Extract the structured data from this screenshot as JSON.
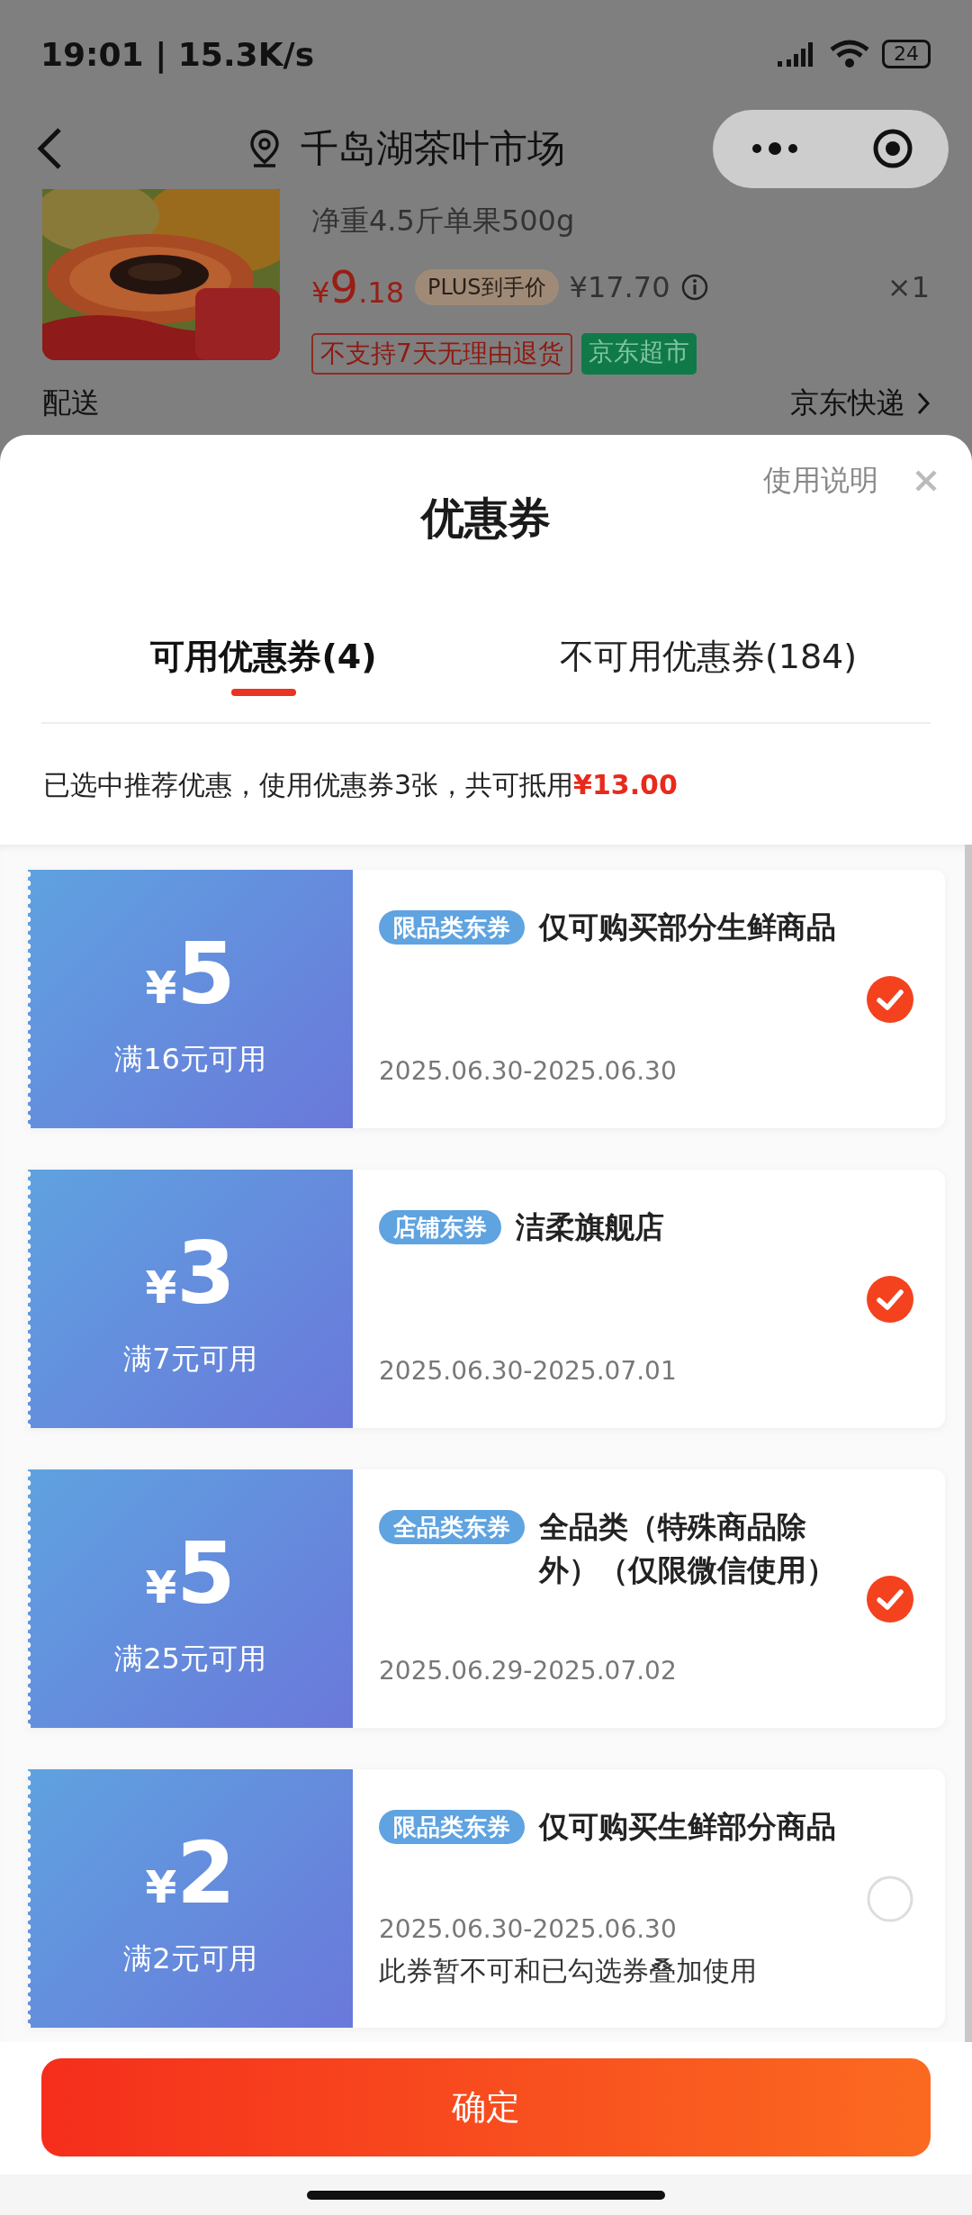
{
  "status_bar": {
    "time": "19:01 | 15.3K/s",
    "battery": "24"
  },
  "nav": {
    "title": "千岛湖茶叶市场"
  },
  "product": {
    "subtitle": "净重4.5斤单果500g",
    "currency": "¥",
    "price_int": "9",
    "price_dec": ".18",
    "price_tag": "PLUS到手价",
    "original_price": "¥17.70",
    "quantity": "×1",
    "tags": [
      {
        "text": "不支持7天无理由退货",
        "kind": "outline"
      },
      {
        "text": "京东超市",
        "kind": "filled"
      }
    ]
  },
  "delivery": {
    "label": "配送",
    "value": "京东快递"
  },
  "sheet": {
    "help": "使用说明",
    "title": "优惠券",
    "tabs": [
      {
        "label": "可用优惠券(4)",
        "selected": true
      },
      {
        "label": "不可用优惠券(184)",
        "selected": false
      }
    ],
    "summary": "已选中推荐优惠，使用优惠券3张，共可抵用",
    "summary_amount": "¥13.00"
  },
  "coupons": [
    {
      "currency": "¥",
      "amount": "5",
      "condition": "满16元可用",
      "badge": "限品类东券",
      "title": "仅可购买部分生鲜商品",
      "validity": "2025.06.30-2025.06.30",
      "selected": true
    },
    {
      "currency": "¥",
      "amount": "3",
      "condition": "满7元可用",
      "badge": "店铺东券",
      "title": "洁柔旗舰店",
      "validity": "2025.06.30-2025.07.01",
      "selected": true
    },
    {
      "currency": "¥",
      "amount": "5",
      "condition": "满25元可用",
      "badge": "全品类东券",
      "title": "全品类（特殊商品除外）（仅限微信使用）",
      "validity": "2025.06.29-2025.07.02",
      "selected": true
    },
    {
      "currency": "¥",
      "amount": "2",
      "condition": "满2元可用",
      "badge": "限品类东券",
      "title": "仅可购买生鲜部分商品",
      "validity": "2025.06.30-2025.06.30",
      "note": "此券暂不可和已勾选券叠加使用",
      "selected": false
    }
  ],
  "confirm_button": "确定"
}
